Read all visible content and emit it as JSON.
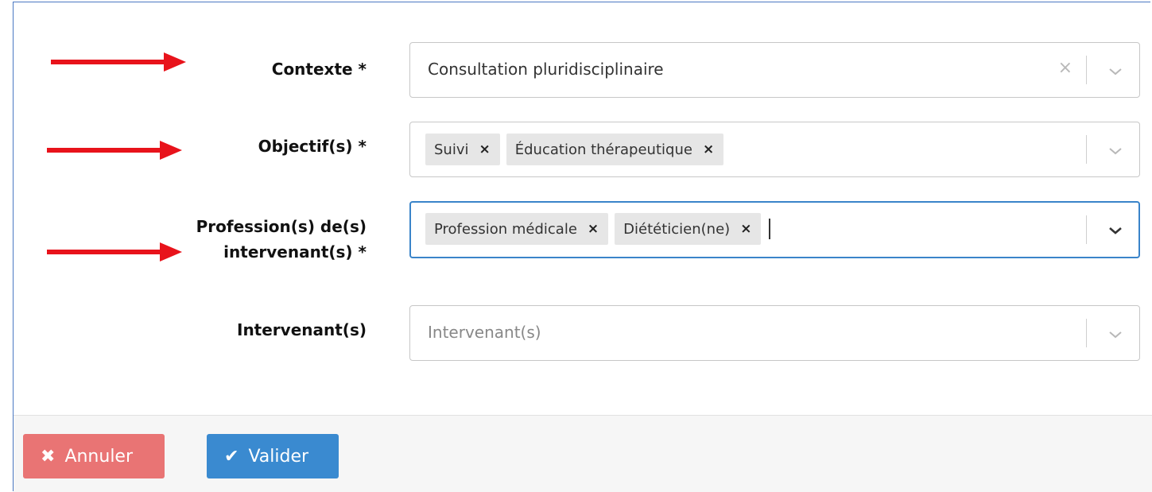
{
  "form": {
    "contexte": {
      "label": "Contexte *",
      "value": "Consultation pluridisciplinaire"
    },
    "objectifs": {
      "label": "Objectif(s) *",
      "tags": [
        "Suivi",
        "Éducation thérapeutique"
      ]
    },
    "professions": {
      "label_line1": "Profession(s) de(s)",
      "label_line2": "intervenant(s) *",
      "tags": [
        "Profession médicale",
        "Diététicien(ne)"
      ]
    },
    "intervenants": {
      "label": "Intervenant(s)",
      "placeholder": "Intervenant(s)"
    }
  },
  "icons": {
    "tag_remove": "×",
    "clear": "×",
    "cancel": "✖",
    "ok": "✔"
  },
  "footer": {
    "cancel_label": "Annuler",
    "ok_label": "Valider"
  },
  "colors": {
    "arrow": "#e8131b",
    "focus_border": "#3a84c9",
    "cancel_bg": "#e97474",
    "ok_bg": "#3a8ad0"
  }
}
